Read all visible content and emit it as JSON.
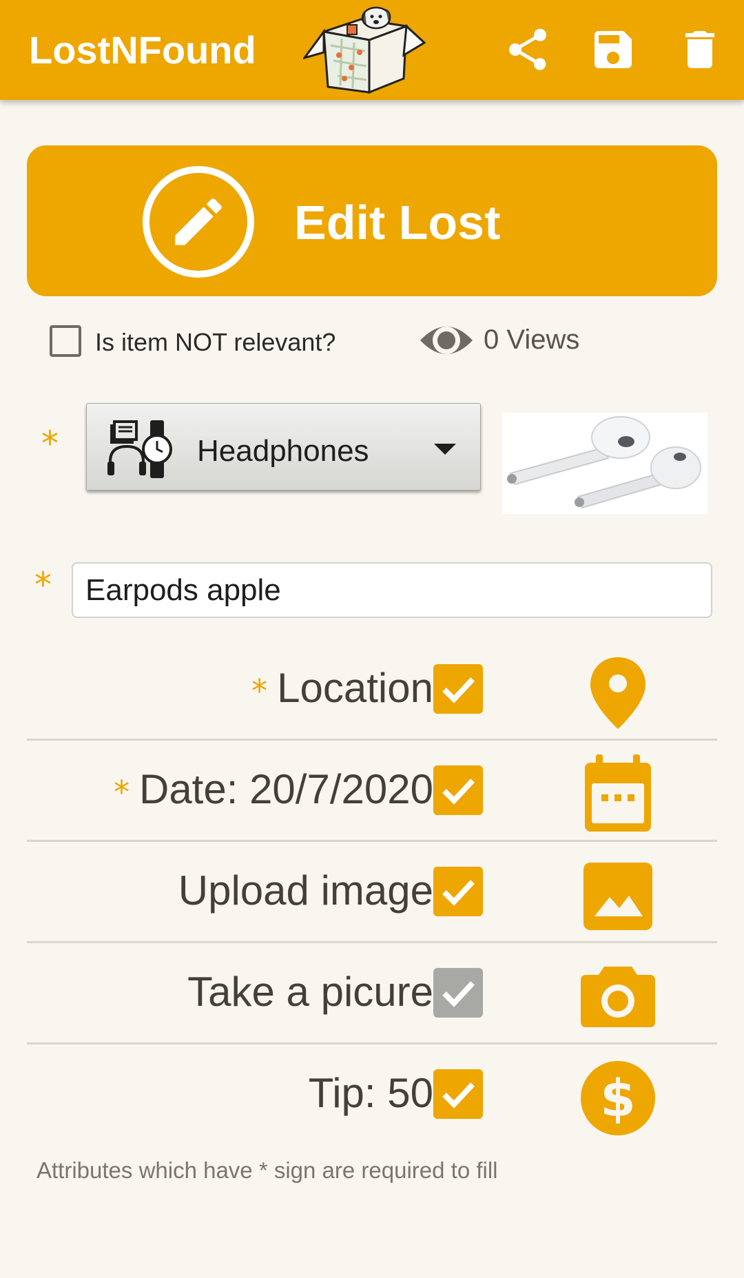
{
  "app": {
    "title": "LostNFound"
  },
  "toolbar": {
    "share_icon": "share-icon",
    "save_icon": "save-icon",
    "delete_icon": "delete-icon"
  },
  "banner": {
    "label": "Edit Lost",
    "icon": "pencil-icon"
  },
  "relevance": {
    "label": "Is item NOT relevant?",
    "checked": false
  },
  "views": {
    "label": "0 Views",
    "icon": "eye-icon"
  },
  "required_mark": "*",
  "category": {
    "selected": "Headphones",
    "icon": "accessories-icon"
  },
  "item_name": {
    "value": "Earpods apple"
  },
  "rows": [
    {
      "label": "Location",
      "required": true,
      "checked": true,
      "icon": "location-pin-icon"
    },
    {
      "label": "Date: 20/7/2020",
      "required": true,
      "checked": true,
      "icon": "calendar-icon"
    },
    {
      "label": "Upload image",
      "required": false,
      "checked": true,
      "icon": "image-icon"
    },
    {
      "label": "Take a picure",
      "required": false,
      "checked": true,
      "disabled": true,
      "icon": "camera-icon"
    },
    {
      "label": "Tip: 50",
      "required": false,
      "checked": true,
      "icon": "dollar-icon"
    }
  ],
  "footnote": "Attributes which have * sign are required to fill",
  "colors": {
    "accent": "#eea600",
    "background": "#f8f6ef",
    "text": "#433f3a",
    "disabled_check": "#a8a8a5"
  }
}
